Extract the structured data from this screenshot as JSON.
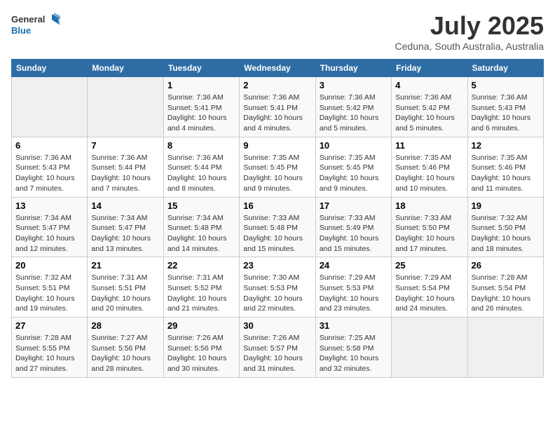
{
  "header": {
    "logo_general": "General",
    "logo_blue": "Blue",
    "title": "July 2025",
    "subtitle": "Ceduna, South Australia, Australia"
  },
  "weekdays": [
    "Sunday",
    "Monday",
    "Tuesday",
    "Wednesday",
    "Thursday",
    "Friday",
    "Saturday"
  ],
  "weeks": [
    [
      null,
      null,
      {
        "day": "1",
        "sunrise": "Sunrise: 7:36 AM",
        "sunset": "Sunset: 5:41 PM",
        "daylight": "Daylight: 10 hours and 4 minutes."
      },
      {
        "day": "2",
        "sunrise": "Sunrise: 7:36 AM",
        "sunset": "Sunset: 5:41 PM",
        "daylight": "Daylight: 10 hours and 4 minutes."
      },
      {
        "day": "3",
        "sunrise": "Sunrise: 7:36 AM",
        "sunset": "Sunset: 5:42 PM",
        "daylight": "Daylight: 10 hours and 5 minutes."
      },
      {
        "day": "4",
        "sunrise": "Sunrise: 7:36 AM",
        "sunset": "Sunset: 5:42 PM",
        "daylight": "Daylight: 10 hours and 5 minutes."
      },
      {
        "day": "5",
        "sunrise": "Sunrise: 7:36 AM",
        "sunset": "Sunset: 5:43 PM",
        "daylight": "Daylight: 10 hours and 6 minutes."
      }
    ],
    [
      {
        "day": "6",
        "sunrise": "Sunrise: 7:36 AM",
        "sunset": "Sunset: 5:43 PM",
        "daylight": "Daylight: 10 hours and 7 minutes."
      },
      {
        "day": "7",
        "sunrise": "Sunrise: 7:36 AM",
        "sunset": "Sunset: 5:44 PM",
        "daylight": "Daylight: 10 hours and 7 minutes."
      },
      {
        "day": "8",
        "sunrise": "Sunrise: 7:36 AM",
        "sunset": "Sunset: 5:44 PM",
        "daylight": "Daylight: 10 hours and 8 minutes."
      },
      {
        "day": "9",
        "sunrise": "Sunrise: 7:35 AM",
        "sunset": "Sunset: 5:45 PM",
        "daylight": "Daylight: 10 hours and 9 minutes."
      },
      {
        "day": "10",
        "sunrise": "Sunrise: 7:35 AM",
        "sunset": "Sunset: 5:45 PM",
        "daylight": "Daylight: 10 hours and 9 minutes."
      },
      {
        "day": "11",
        "sunrise": "Sunrise: 7:35 AM",
        "sunset": "Sunset: 5:46 PM",
        "daylight": "Daylight: 10 hours and 10 minutes."
      },
      {
        "day": "12",
        "sunrise": "Sunrise: 7:35 AM",
        "sunset": "Sunset: 5:46 PM",
        "daylight": "Daylight: 10 hours and 11 minutes."
      }
    ],
    [
      {
        "day": "13",
        "sunrise": "Sunrise: 7:34 AM",
        "sunset": "Sunset: 5:47 PM",
        "daylight": "Daylight: 10 hours and 12 minutes."
      },
      {
        "day": "14",
        "sunrise": "Sunrise: 7:34 AM",
        "sunset": "Sunset: 5:47 PM",
        "daylight": "Daylight: 10 hours and 13 minutes."
      },
      {
        "day": "15",
        "sunrise": "Sunrise: 7:34 AM",
        "sunset": "Sunset: 5:48 PM",
        "daylight": "Daylight: 10 hours and 14 minutes."
      },
      {
        "day": "16",
        "sunrise": "Sunrise: 7:33 AM",
        "sunset": "Sunset: 5:48 PM",
        "daylight": "Daylight: 10 hours and 15 minutes."
      },
      {
        "day": "17",
        "sunrise": "Sunrise: 7:33 AM",
        "sunset": "Sunset: 5:49 PM",
        "daylight": "Daylight: 10 hours and 15 minutes."
      },
      {
        "day": "18",
        "sunrise": "Sunrise: 7:33 AM",
        "sunset": "Sunset: 5:50 PM",
        "daylight": "Daylight: 10 hours and 17 minutes."
      },
      {
        "day": "19",
        "sunrise": "Sunrise: 7:32 AM",
        "sunset": "Sunset: 5:50 PM",
        "daylight": "Daylight: 10 hours and 18 minutes."
      }
    ],
    [
      {
        "day": "20",
        "sunrise": "Sunrise: 7:32 AM",
        "sunset": "Sunset: 5:51 PM",
        "daylight": "Daylight: 10 hours and 19 minutes."
      },
      {
        "day": "21",
        "sunrise": "Sunrise: 7:31 AM",
        "sunset": "Sunset: 5:51 PM",
        "daylight": "Daylight: 10 hours and 20 minutes."
      },
      {
        "day": "22",
        "sunrise": "Sunrise: 7:31 AM",
        "sunset": "Sunset: 5:52 PM",
        "daylight": "Daylight: 10 hours and 21 minutes."
      },
      {
        "day": "23",
        "sunrise": "Sunrise: 7:30 AM",
        "sunset": "Sunset: 5:53 PM",
        "daylight": "Daylight: 10 hours and 22 minutes."
      },
      {
        "day": "24",
        "sunrise": "Sunrise: 7:29 AM",
        "sunset": "Sunset: 5:53 PM",
        "daylight": "Daylight: 10 hours and 23 minutes."
      },
      {
        "day": "25",
        "sunrise": "Sunrise: 7:29 AM",
        "sunset": "Sunset: 5:54 PM",
        "daylight": "Daylight: 10 hours and 24 minutes."
      },
      {
        "day": "26",
        "sunrise": "Sunrise: 7:28 AM",
        "sunset": "Sunset: 5:54 PM",
        "daylight": "Daylight: 10 hours and 26 minutes."
      }
    ],
    [
      {
        "day": "27",
        "sunrise": "Sunrise: 7:28 AM",
        "sunset": "Sunset: 5:55 PM",
        "daylight": "Daylight: 10 hours and 27 minutes."
      },
      {
        "day": "28",
        "sunrise": "Sunrise: 7:27 AM",
        "sunset": "Sunset: 5:56 PM",
        "daylight": "Daylight: 10 hours and 28 minutes."
      },
      {
        "day": "29",
        "sunrise": "Sunrise: 7:26 AM",
        "sunset": "Sunset: 5:56 PM",
        "daylight": "Daylight: 10 hours and 30 minutes."
      },
      {
        "day": "30",
        "sunrise": "Sunrise: 7:26 AM",
        "sunset": "Sunset: 5:57 PM",
        "daylight": "Daylight: 10 hours and 31 minutes."
      },
      {
        "day": "31",
        "sunrise": "Sunrise: 7:25 AM",
        "sunset": "Sunset: 5:58 PM",
        "daylight": "Daylight: 10 hours and 32 minutes."
      },
      null,
      null
    ]
  ]
}
